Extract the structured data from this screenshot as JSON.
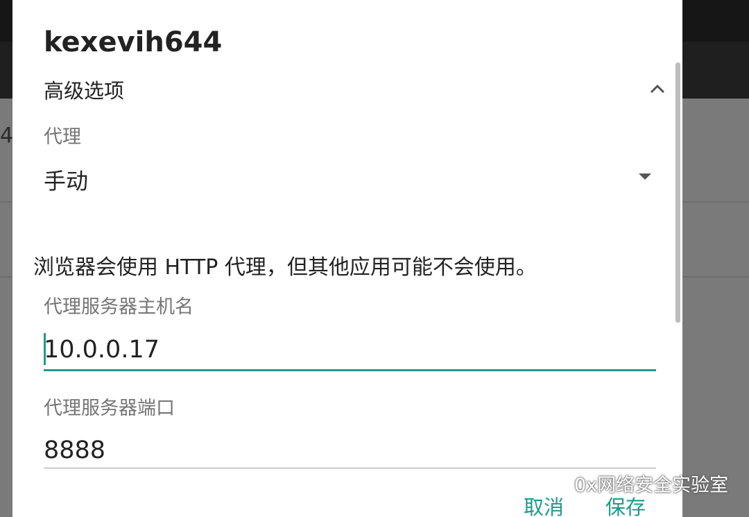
{
  "background": {
    "fragment_text": "4"
  },
  "dialog": {
    "title": "kexevih644",
    "advanced": {
      "label": "高级选项"
    },
    "proxy": {
      "label": "代理",
      "value": "手动"
    },
    "hint": "浏览器会使用 HTTP 代理，但其他应用可能不会使用。",
    "host": {
      "label": "代理服务器主机名",
      "value": "10.0.0.17"
    },
    "port": {
      "label": "代理服务器端口",
      "value": "8888"
    },
    "buttons": {
      "cancel": "取消",
      "save": "保存"
    }
  },
  "watermark": {
    "text": "0x网络安全实验室",
    "icon": "wechat-icon"
  },
  "colors": {
    "accent": "#1f9a8a",
    "dialog_bg": "#ffffff",
    "scrim": "#7a7a7a"
  }
}
